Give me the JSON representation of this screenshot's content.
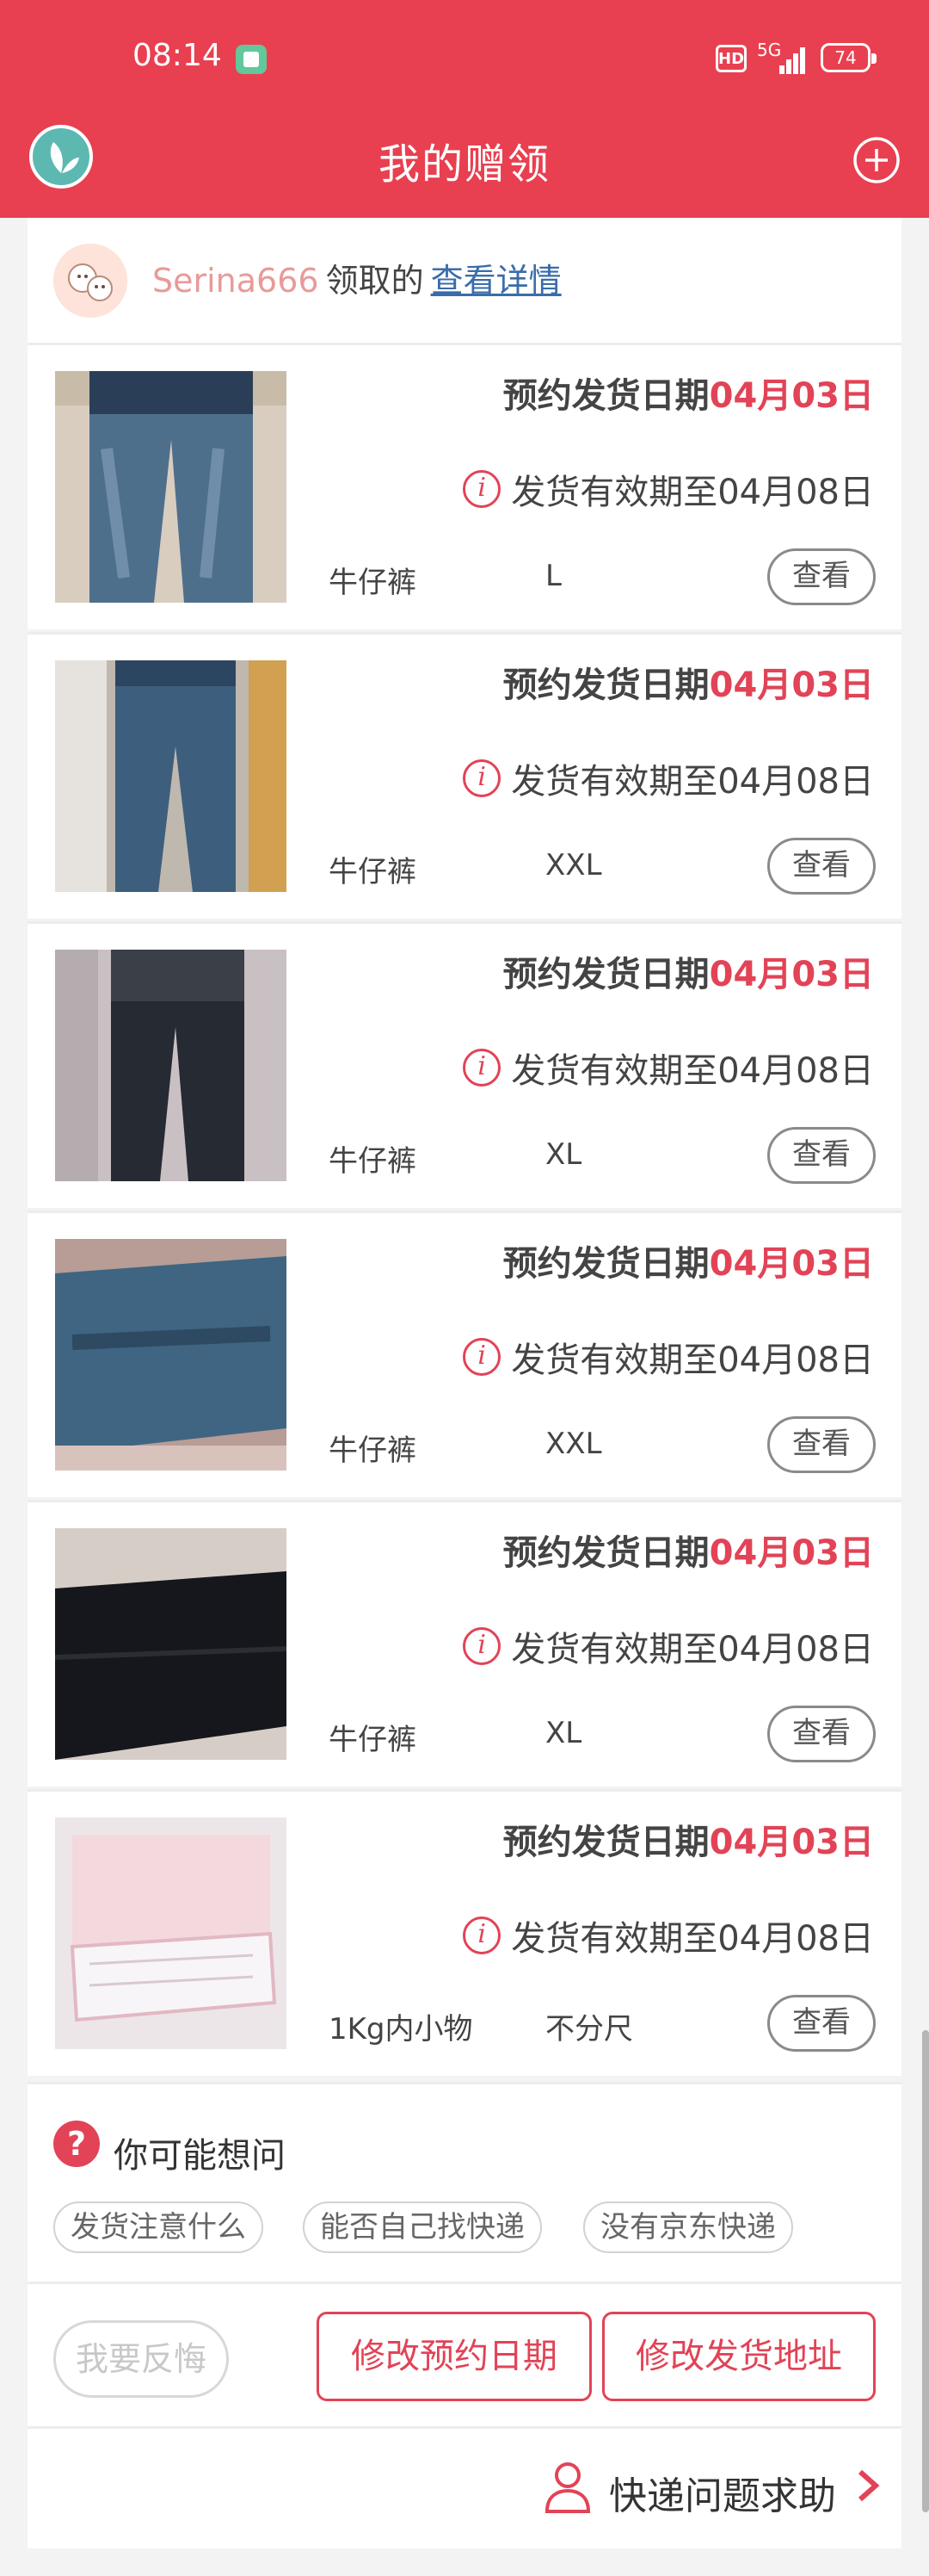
{
  "status_bar": {
    "time": "08:14",
    "hd": "HD",
    "network": "5G",
    "battery": "74"
  },
  "header": {
    "title": "我的赠领",
    "add_icon": "plus-circle-icon",
    "logo_icon": "leaf-logo-icon"
  },
  "giver": {
    "username": "Serina666",
    "label": "领取的",
    "link": "查看详情"
  },
  "items": [
    {
      "ship_label": "预约发货日期",
      "ship_date": "04月03日",
      "valid_text": "发货有效期至04月08日",
      "category": "牛仔裤",
      "size": "L",
      "view": "查看"
    },
    {
      "ship_label": "预约发货日期",
      "ship_date": "04月03日",
      "valid_text": "发货有效期至04月08日",
      "category": "牛仔裤",
      "size": "XXL",
      "view": "查看"
    },
    {
      "ship_label": "预约发货日期",
      "ship_date": "04月03日",
      "valid_text": "发货有效期至04月08日",
      "category": "牛仔裤",
      "size": "XL",
      "view": "查看"
    },
    {
      "ship_label": "预约发货日期",
      "ship_date": "04月03日",
      "valid_text": "发货有效期至04月08日",
      "category": "牛仔裤",
      "size": "XXL",
      "view": "查看"
    },
    {
      "ship_label": "预约发货日期",
      "ship_date": "04月03日",
      "valid_text": "发货有效期至04月08日",
      "category": "牛仔裤",
      "size": "XL",
      "view": "查看"
    },
    {
      "ship_label": "预约发货日期",
      "ship_date": "04月03日",
      "valid_text": "发货有效期至04月08日",
      "category": "1Kg内小物",
      "size": "不分尺",
      "view": "查看"
    }
  ],
  "faq": {
    "title": "你可能想问",
    "chips": [
      "发货注意什么",
      "能否自己找快递",
      "没有京东快递"
    ]
  },
  "actions": {
    "regret": "我要反悔",
    "change_date": "修改预约日期",
    "change_address": "修改发货地址"
  },
  "help": {
    "label": "快递问题求助"
  },
  "colors": {
    "brand": "#e84050",
    "accent_red": "#e24356",
    "link": "#3a6caa"
  }
}
